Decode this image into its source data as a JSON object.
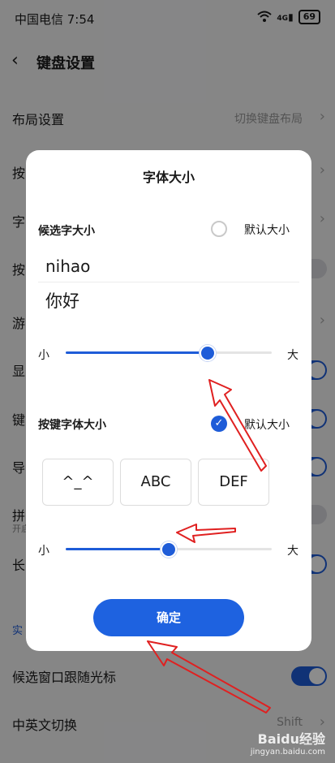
{
  "status_bar": {
    "carrier_time": "中国电信 7:54",
    "signal": "4G",
    "battery": "69"
  },
  "header": {
    "title": "键盘设置"
  },
  "settings": {
    "layout": {
      "label": "布局设置",
      "value": "切换键盘布局"
    },
    "rows_partial": [
      "按",
      "字",
      "按",
      "游",
      "显",
      "键",
      "导",
      "拼",
      "长"
    ],
    "pinyin_sub": "开启",
    "section": "实",
    "follow_cursor": "候选窗口跟随光标",
    "lang_switch": {
      "label": "中英文切换",
      "value": "Shift"
    }
  },
  "dialog": {
    "title": "字体大小",
    "candidate": {
      "label": "候选字大小",
      "default_label": "默认大小",
      "default_checked": false,
      "preview_latin": "nihao",
      "preview_cjk": "你好",
      "min_label": "小",
      "max_label": "大",
      "level": 0.69
    },
    "key": {
      "label": "按键字体大小",
      "default_label": "默认大小",
      "default_checked": true,
      "keys": [
        "^_^",
        "ABC",
        "DEF"
      ],
      "min_label": "小",
      "max_label": "大",
      "level": 0.5
    },
    "confirm": "确定"
  },
  "watermark": {
    "main": "Baidu经验",
    "sub": "jingyan.baidu.com"
  },
  "colors": {
    "accent": "#1e5cd8",
    "arrow": "#e02020"
  }
}
